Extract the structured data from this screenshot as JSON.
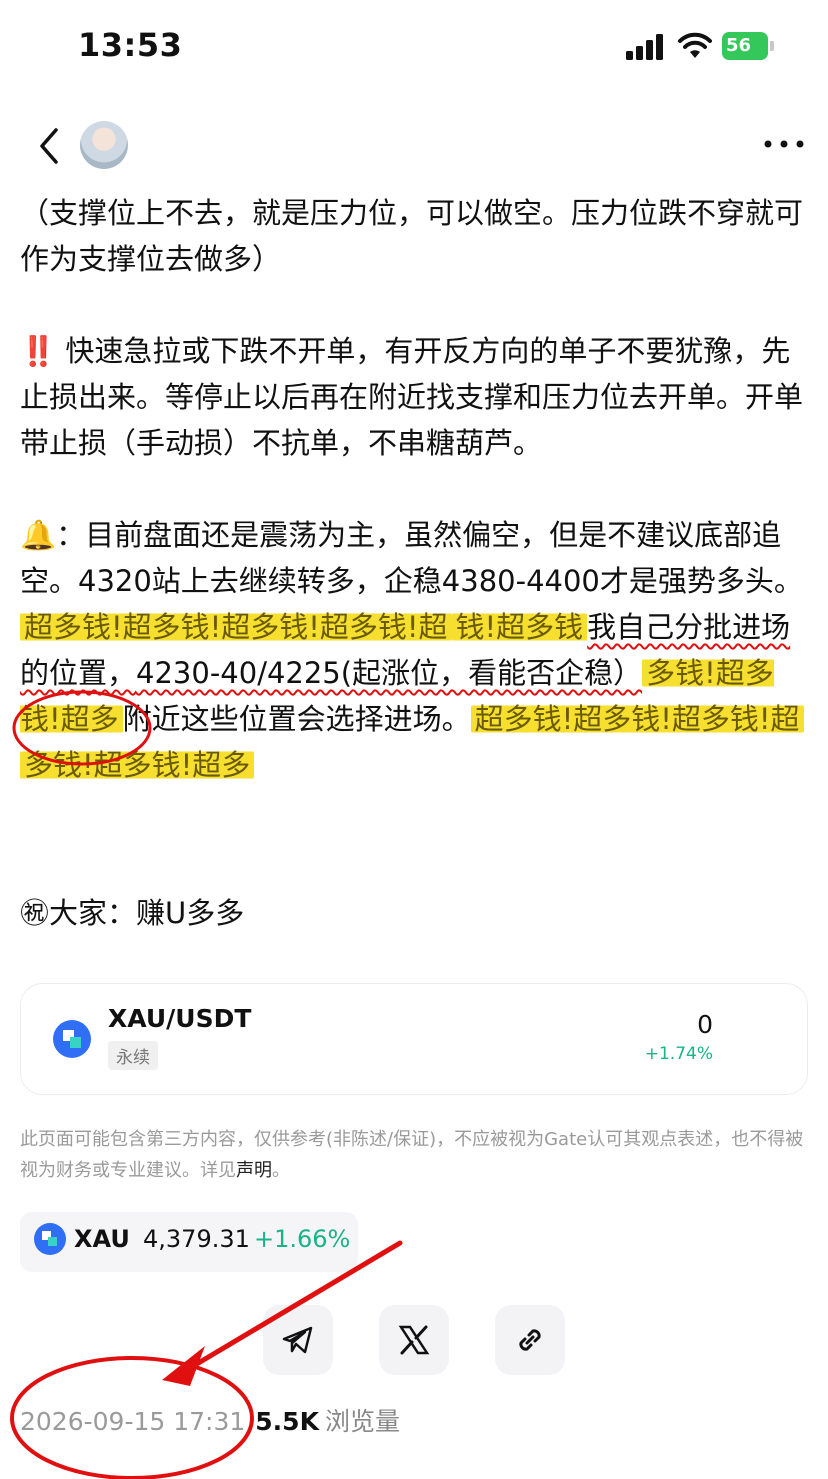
{
  "status_bar": {
    "time": "13:53",
    "battery": "56"
  },
  "nav": {
    "back_icon": "chevron-left-icon",
    "more_icon": "more-horizontal-icon"
  },
  "post": {
    "p1": "（支撑位上不去，就是压力位，可以做空。压力位跌不穿就可作为支撑位去做多）",
    "p2_icon": "‼️",
    "p2": " 快速急拉或下跌不开单，有开反方向的单子不要犹豫，先止损出来。等停止以后再在附近找支撑和压力位去开单。开单带止损（手动损）不抗单，不串糖葫芦。",
    "p3_icon": "🔔",
    "p3_a": "：目前盘面还是震荡为主，虽然偏空，但是不建议底部追空。4320站上去继续转多，企稳4380-4400才是强势多头。",
    "mosaic": "超多钱!超多钱!超多钱!超多钱!超",
    "mosaic2": "钱!超多钱",
    "p3_b": "我自己分批进场的位置，",
    "p3_c": "4230-40",
    "p3_d": "/4225(起涨位，看能否企稳）",
    "mosaic3": "多钱!超多钱!超多",
    "p3_e": "附近这些位置会选择进场。",
    "mosaic4": "超多钱!超多钱!超多钱!超",
    "mosaic5": "多钱!超多钱!超多",
    "blessing": "㊗大家：赚U多多"
  },
  "pair_card": {
    "symbol": "XAU/USDT",
    "tag": "永续",
    "price": "0",
    "change": "+1.74%"
  },
  "disclaimer": {
    "text": "此页面可能包含第三方内容，仅供参考(非陈述/保证)，不应被视为Gate认可其观点表述，也不得被视为财务或专业建议。详见",
    "link": "声明",
    "end": "。"
  },
  "ticker": {
    "symbol": "XAU",
    "price": "4,379.31",
    "change": "+1.66%"
  },
  "share": {
    "telegram_icon": "telegram-icon",
    "x_icon": "x-icon",
    "link_icon": "link-icon"
  },
  "meta": {
    "date": "2026-09-15 17:31",
    "views": "5.5K",
    "views_label": "浏览量"
  },
  "colors": {
    "highlight": "#f6df2f",
    "positive": "#19b388",
    "annotation_red": "#e01010",
    "coin_blue": "#2f6ef5"
  }
}
